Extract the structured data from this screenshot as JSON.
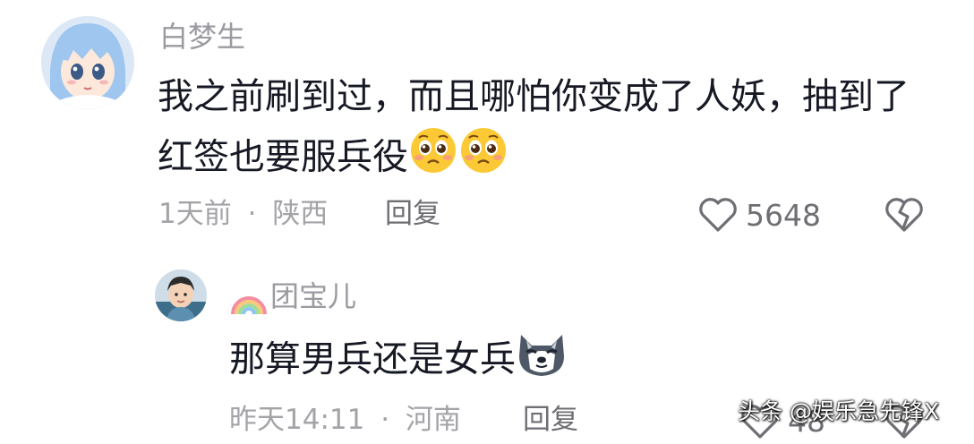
{
  "comment": {
    "username": "白梦生",
    "text": "我之前刷到过，而且哪怕你变成了人妖，抽到了红签也要服兵役",
    "emojis": [
      "pleading-face-emoji",
      "pleading-face-emoji"
    ],
    "time": "1天前",
    "separator": "·",
    "location": "陕西",
    "reply_label": "回复",
    "like_count": "5648"
  },
  "reply": {
    "username": "团宝儿",
    "name_prefix_icon": "rainbow-icon",
    "text": "那算男兵还是女兵",
    "emoji": "wolf-face-emoji",
    "time": "昨天14:11",
    "separator": "·",
    "location": "河南",
    "reply_label": "回复",
    "like_count": "48"
  },
  "watermark": "头条 @娱乐急先锋X",
  "colors": {
    "text_primary": "#161823",
    "text_secondary": "#9a9aa0",
    "icon_gray": "#6e6e74"
  }
}
